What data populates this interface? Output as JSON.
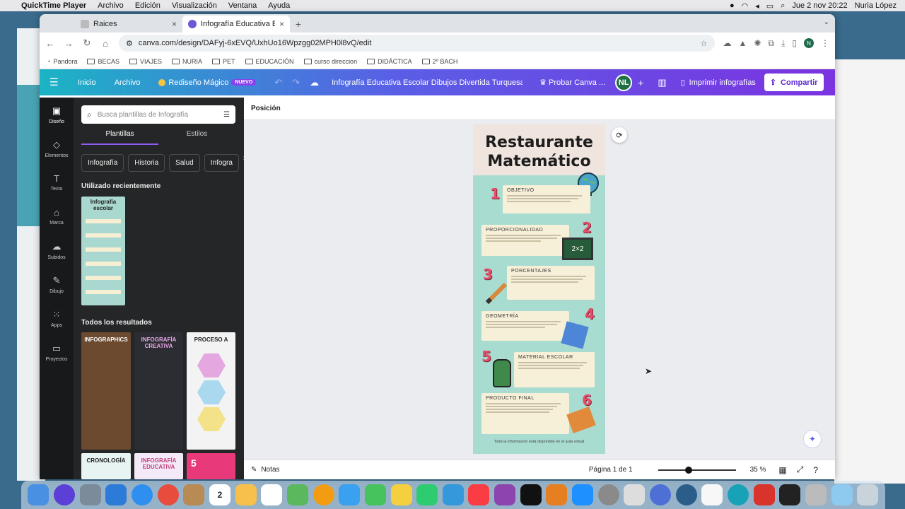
{
  "menubar": {
    "app": "QuickTime Player",
    "items": [
      "Archivo",
      "Edición",
      "Visualización",
      "Ventana",
      "Ayuda"
    ],
    "clock": "Jue 2 nov  20:22",
    "user": "Nuria López"
  },
  "browser": {
    "tabs": [
      {
        "title": "Raices",
        "active": false
      },
      {
        "title": "Infografía Educativa Escolar",
        "active": true
      }
    ],
    "url": "canva.com/design/DAFyj-6xEVQ/UxhUo16Wpzgg02MPH0l8vQ/edit",
    "account_initial": "N",
    "bookmarks": [
      "Pandora",
      "BECAS",
      "VIAJES",
      "NURIA",
      "PET",
      "EDUCACIÓN",
      "curso direccion",
      "DIDÁCTICA",
      "2º BACH"
    ]
  },
  "canva_header": {
    "inicio": "Inicio",
    "archivo": "Archivo",
    "magic": "Rediseño Mágico",
    "new_badge": "NUEVO",
    "doc_title": "Infografía Educativa Escolar Dibujos Divertida Turquesa...",
    "try_pro": "Probar Canva ...",
    "user_initials": "NL",
    "print": "Imprimir infografías",
    "share": "Compartir"
  },
  "rail": [
    {
      "label": "Diseño",
      "icon": "layout-icon"
    },
    {
      "label": "Elementos",
      "icon": "shapes-icon"
    },
    {
      "label": "Texto",
      "icon": "text-icon"
    },
    {
      "label": "Marca",
      "icon": "brand-icon"
    },
    {
      "label": "Subidos",
      "icon": "cloud-upload-icon"
    },
    {
      "label": "Dibujo",
      "icon": "pen-icon"
    },
    {
      "label": "Apps",
      "icon": "apps-grid-icon"
    },
    {
      "label": "Proyectos",
      "icon": "folder-icon"
    }
  ],
  "panel": {
    "search_placeholder": "Busca plantillas de Infografía",
    "tab_templates": "Plantillas",
    "tab_styles": "Estilos",
    "chips": [
      "Infografía",
      "Historia",
      "Salud",
      "Infogra"
    ],
    "recent_heading": "Utilizado recientemente",
    "recent_thumb_title": "Infografía escolar",
    "all_heading": "Todos los resultados",
    "results": [
      {
        "title": "INFOGRAPHICS"
      },
      {
        "title": "INFOGRAFÍA CREATIVA"
      },
      {
        "title": "PROCESO A"
      },
      {
        "title": "CRONOLOGÍA"
      },
      {
        "title": "INFOGRAFÍA EDUCATIVA"
      },
      {
        "title": "5"
      }
    ]
  },
  "workarea": {
    "position_label": "Posición",
    "notes_label": "Notas",
    "page_indicator": "Página 1 de 1",
    "zoom": "35 %",
    "zoom_fraction": 0.35
  },
  "infographic": {
    "title_line1": "Restaurante",
    "title_line2": "Matemático",
    "sections": [
      {
        "number": "1",
        "heading": "OBJETIVO"
      },
      {
        "number": "2",
        "heading": "PROPORCIONALIDAD"
      },
      {
        "number": "3",
        "heading": "PORCENTAJES"
      },
      {
        "number": "4",
        "heading": "GEOMETRÍA"
      },
      {
        "number": "5",
        "heading": "MATERIAL ESCOLAR"
      },
      {
        "number": "6",
        "heading": "PRODUCTO FINAL"
      }
    ],
    "chalkboard_text": "2×2",
    "footer": "Toda la información está disponible en el aula virtual"
  },
  "colors": {
    "canva_gradient_start": "#1bb4c4",
    "canva_gradient_end": "#7b33e0",
    "infographic_bg": "#a9dcd1",
    "number_color": "#e84d6a"
  }
}
